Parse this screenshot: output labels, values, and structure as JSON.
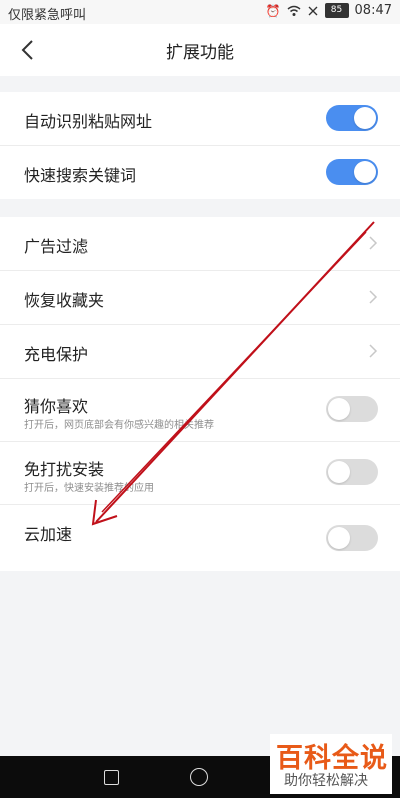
{
  "status_bar": {
    "carrier": "仅限紧急呼叫",
    "battery": "85",
    "time": "08:47",
    "icons": [
      "alarm-icon",
      "wifi-icon",
      "no-signal-icon"
    ]
  },
  "header": {
    "title": "扩展功能",
    "back_icon": "chevron-left-icon"
  },
  "group1": [
    {
      "label": "自动识别粘贴网址",
      "toggle_on": true
    },
    {
      "label": "快速搜索关键词",
      "toggle_on": true
    }
  ],
  "group2": [
    {
      "label": "广告过滤",
      "control": "chevron"
    },
    {
      "label": "恢复收藏夹",
      "control": "chevron"
    },
    {
      "label": "充电保护",
      "control": "chevron"
    },
    {
      "label": "猜你喜欢",
      "sub": "打开后，网页底部会有你感兴趣的相关推荐",
      "toggle_on": false
    },
    {
      "label": "免打扰安装",
      "sub": "打开后，快速安装推荐的应用",
      "toggle_on": false
    },
    {
      "label": "云加速",
      "toggle_on": false
    }
  ],
  "colors": {
    "accent": "#4a8ef0",
    "toggle_off": "#dcdcdc",
    "annotation_arrow": "#c0101a"
  },
  "watermark": {
    "brand": "百科全说",
    "slogan": "助你轻松解决"
  },
  "navbar": {
    "icons": [
      "recent-apps-icon",
      "home-icon"
    ]
  }
}
